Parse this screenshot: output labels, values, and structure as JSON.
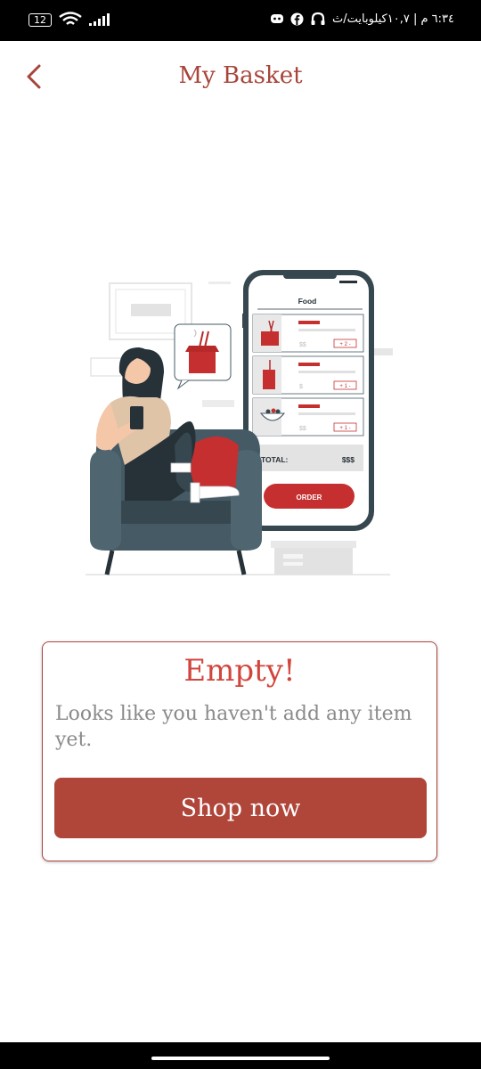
{
  "status_bar": {
    "battery": "12",
    "time": "٦:٣٤ م | ١٠,٧كيلوبايت/ث"
  },
  "header": {
    "title": "My Basket"
  },
  "illustration": {
    "screen_title": "Food",
    "price_1": "$$",
    "qty_1": "+ 2 -",
    "price_2": "$",
    "qty_2": "+ 1 -",
    "price_3": "$$",
    "qty_3": "+ 1 -",
    "total_label": "TOTAL:",
    "total_value": "$$$",
    "order_label": "ORDER"
  },
  "empty_state": {
    "title": "Empty!",
    "message": "Looks like you haven't add any item yet.",
    "button_label": "Shop now"
  },
  "colors": {
    "accent": "#b0453a",
    "title": "#a8453b",
    "empty_title": "#d1463c"
  }
}
